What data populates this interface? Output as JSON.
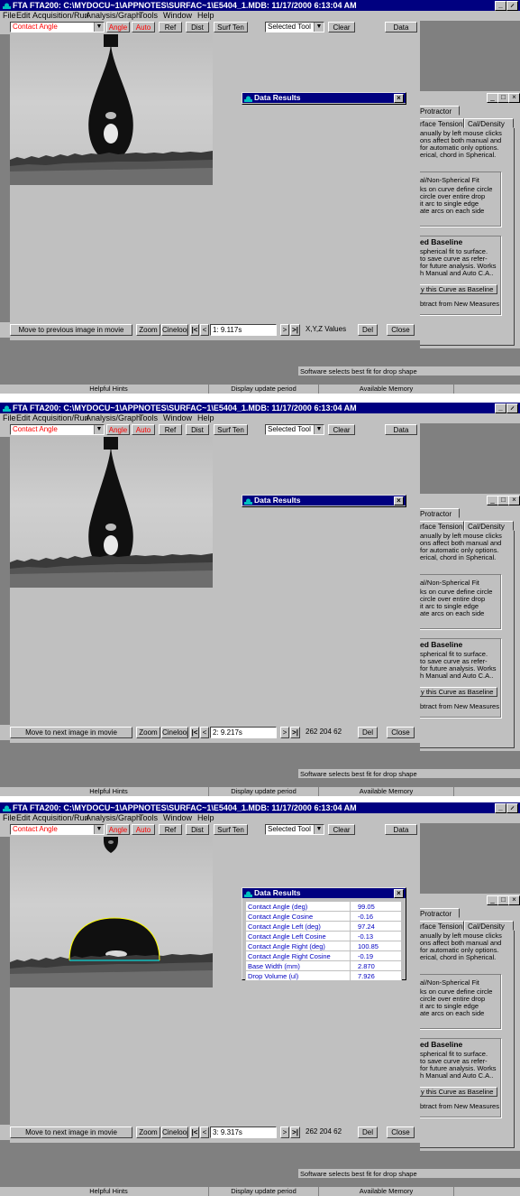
{
  "app": {
    "title": "FTA FTA200: C:\\MYDOCU~1\\APPNOTES\\SURFAC~1\\E5404_1.MDB: 11/17/2000 6:13:04 AM",
    "menu": [
      "File",
      "Edit",
      "Acquisition/Run",
      "Analysis/Graph",
      "Tools",
      "Window",
      "Help"
    ],
    "window_buttons": [
      "_",
      "̷",
      "×"
    ]
  },
  "toolbar": {
    "mode_select": "Contact Angle",
    "angle_label": "Angle",
    "auto_label": "Auto",
    "ref_label": "Ref",
    "dist_label": "Dist",
    "surften_label": "Surf Ten",
    "tool_select": "Selected Tool",
    "clear_label": "Clear",
    "data_label": "Data"
  },
  "data_results_title": "Data Results",
  "side_panel": {
    "tab_protractor": "Protractor",
    "tab_surface_tension": "rface Tension",
    "tab_cal_density": "Cal/Density",
    "intro_lines": [
      "anually by left mouse clicks",
      "ons affect both manual and",
      "for automatic only options.",
      "erical, chord in Spherical."
    ],
    "fit_title": "al/Non-Spherical Fit",
    "fit_lines": [
      "ks on curve define circle",
      "circle over entire drop",
      "it arc to single edge",
      "ate arcs on each side"
    ],
    "baseline_title": "ed Baseline",
    "baseline_lines": [
      "spherical fit to surface.",
      "to save curve as refer-",
      "for future analysis.  Works",
      "h Manual and Auto C.A.."
    ],
    "baseline_button": "y this Curve as Baseline",
    "subtract_text": "btract from New Measures",
    "status_text": "Software selects best fit for drop shape"
  },
  "statusbar": [
    "Helpful Hints",
    "Display update period",
    "Available Memory"
  ],
  "bottom_common": {
    "zoom": "Zoom",
    "cineloop": "Cineloop",
    "first": "|<",
    "prev": "<",
    "next": ">",
    "last": ">|",
    "del": "Del",
    "close": "Close"
  },
  "frames": [
    {
      "hint": "Move to previous image in movie",
      "frame_time": "1: 9.117s",
      "xyz": "X,Y,Z Values"
    },
    {
      "hint": "Move to next image in movie",
      "frame_time": "2: 9.217s",
      "xyz": "262  204  62"
    },
    {
      "hint": "Move to next image in movie",
      "frame_time": "3: 9.317s",
      "xyz": "262  204  62"
    }
  ],
  "data_results": {
    "rows": [
      {
        "label": "Contact Angle (deg)",
        "value": "99.05"
      },
      {
        "label": "Contact Angle Cosine",
        "value": "-0.16"
      },
      {
        "label": "Contact Angle Left (deg)",
        "value": "97.24"
      },
      {
        "label": "Contact Angle Left Cosine",
        "value": "-0.13"
      },
      {
        "label": "Contact Angle Right (deg)",
        "value": "100.85"
      },
      {
        "label": "Contact Angle Right Cosine",
        "value": "-0.19"
      },
      {
        "label": "Base Width (mm)",
        "value": "2.870"
      },
      {
        "label": "Drop Volume (ul)",
        "value": "7.926"
      }
    ]
  },
  "colors": {
    "title_bg": "#000080",
    "face": "#c0c0c0",
    "mdi_bg": "#808080",
    "red_text": "#ff0000",
    "table_text": "#0000c0",
    "fit_outline": "#ffff00",
    "baseline_line": "#00ffff"
  }
}
